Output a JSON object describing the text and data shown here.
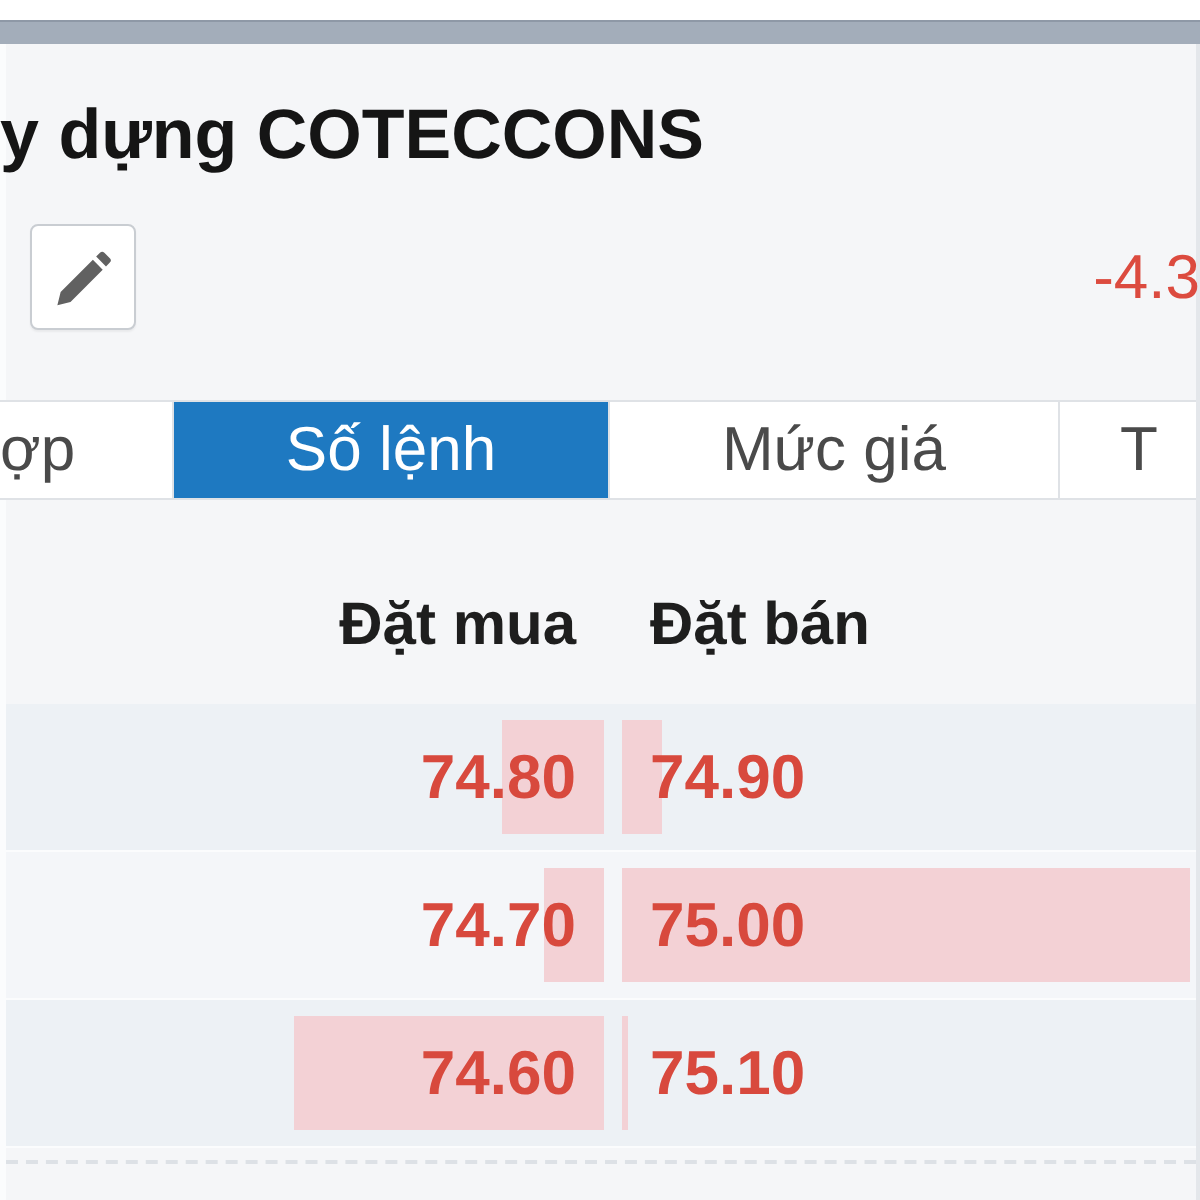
{
  "title": "y dựng COTECCONS",
  "toolbar": {
    "change": "-4.3"
  },
  "tabs": [
    {
      "label": "ợp",
      "selected": false
    },
    {
      "label": "Số lệnh",
      "selected": true
    },
    {
      "label": "Mức giá",
      "selected": false
    },
    {
      "label": "T",
      "selected": false
    }
  ],
  "order_book": {
    "columns": [
      "Đặt mua",
      "Đặt bán"
    ],
    "rows": [
      {
        "bid": {
          "price": "74.80",
          "level": 0.17
        },
        "ask": {
          "price": "74.90",
          "level": 0.07
        }
      },
      {
        "bid": {
          "price": "74.70",
          "level": 0.1
        },
        "ask": {
          "price": "75.00",
          "level": 0.99
        }
      },
      {
        "bid": {
          "price": "74.60",
          "level": 0.52
        },
        "ask": {
          "price": "75.10",
          "level": 0.01
        }
      }
    ]
  }
}
